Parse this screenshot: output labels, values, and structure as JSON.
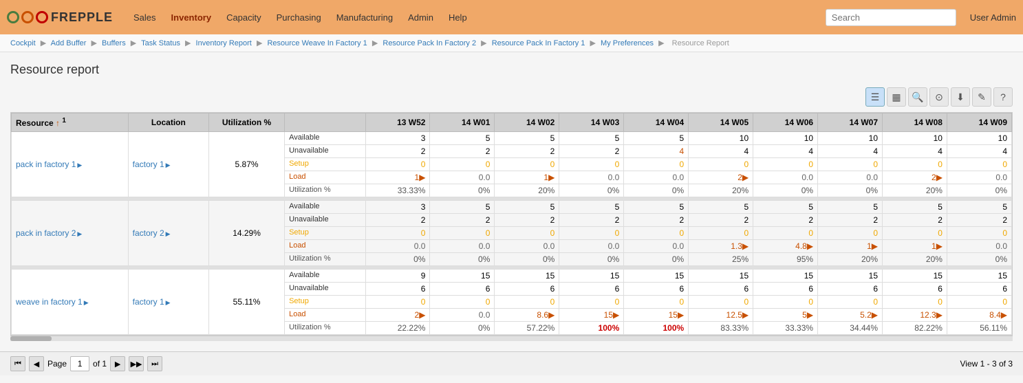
{
  "header": {
    "logo_text": "FREPPLE",
    "nav": [
      "Sales",
      "Inventory",
      "Capacity",
      "Purchasing",
      "Manufacturing",
      "Admin",
      "Help"
    ],
    "search_placeholder": "Search",
    "user": "User Admin"
  },
  "breadcrumb": {
    "items": [
      "Cockpit",
      "Add Buffer",
      "Buffers",
      "Task Status",
      "Inventory Report",
      "Resource Weave In Factory 1",
      "Resource Pack In Factory 2",
      "Resource Pack In Factory 1",
      "My Preferences",
      "Resource Report"
    ]
  },
  "page": {
    "title": "Resource report"
  },
  "toolbar": {
    "buttons": [
      "⊞",
      "🖼",
      "🔍",
      "⊙",
      "⬇",
      "✎",
      "?"
    ]
  },
  "table": {
    "col_headers": [
      "Resource",
      "Location",
      "Utilization %",
      "",
      "13 W52",
      "14 W01",
      "14 W02",
      "14 W03",
      "14 W04",
      "14 W05",
      "14 W06",
      "14 W07",
      "14 W08",
      "14 W09"
    ],
    "row_labels": [
      "Available",
      "Unavailable",
      "Setup",
      "Load",
      "Utilization %"
    ],
    "rows": [
      {
        "resource": "pack in factory 1",
        "location": "factory 1",
        "util_pct": "5.87%",
        "data": {
          "available": [
            3,
            5,
            5,
            5,
            5,
            10,
            10,
            10,
            10,
            10
          ],
          "unavailable": [
            2,
            2,
            2,
            2,
            4,
            4,
            4,
            4,
            4,
            4
          ],
          "setup": [
            "0",
            "0",
            "0",
            "0",
            "0",
            "0",
            "0",
            "0",
            "0",
            "0"
          ],
          "load": [
            "1▶",
            "0.0",
            "1▶",
            "0.0",
            "0.0",
            "2▶",
            "0.0",
            "0.0",
            "2▶",
            "0.0"
          ],
          "utilization": [
            "33.33%",
            "0%",
            "20%",
            "0%",
            "0%",
            "20%",
            "0%",
            "0%",
            "20%",
            "0%"
          ],
          "load_highlight": [
            true,
            false,
            true,
            false,
            false,
            true,
            false,
            false,
            true,
            false
          ],
          "util_red": [
            false,
            false,
            false,
            false,
            false,
            false,
            false,
            false,
            false,
            false
          ]
        }
      },
      {
        "resource": "pack in factory 2",
        "location": "factory 2",
        "util_pct": "14.29%",
        "data": {
          "available": [
            3,
            5,
            5,
            5,
            5,
            5,
            5,
            5,
            5,
            5
          ],
          "unavailable": [
            2,
            2,
            2,
            2,
            2,
            2,
            2,
            2,
            2,
            2
          ],
          "setup": [
            "0",
            "0",
            "0",
            "0",
            "0",
            "0",
            "0",
            "0",
            "0",
            "0"
          ],
          "load": [
            "0.0",
            "0.0",
            "0.0",
            "0.0",
            "0.0",
            "1.3▶",
            "4.8▶",
            "1▶",
            "1▶",
            "0.0"
          ],
          "utilization": [
            "0%",
            "0%",
            "0%",
            "0%",
            "0%",
            "25%",
            "95%",
            "20%",
            "20%",
            "0%"
          ],
          "load_highlight": [
            false,
            false,
            false,
            false,
            false,
            true,
            true,
            true,
            true,
            false
          ],
          "util_red": [
            false,
            false,
            false,
            false,
            false,
            false,
            false,
            false,
            false,
            false
          ]
        }
      },
      {
        "resource": "weave in factory 1",
        "location": "factory 1",
        "util_pct": "55.11%",
        "data": {
          "available": [
            9,
            15,
            15,
            15,
            15,
            15,
            15,
            15,
            15,
            15
          ],
          "unavailable": [
            6,
            6,
            6,
            6,
            6,
            6,
            6,
            6,
            6,
            6
          ],
          "setup": [
            "0",
            "0",
            "0",
            "0",
            "0",
            "0",
            "0",
            "0",
            "0",
            "0"
          ],
          "load": [
            "2▶",
            "0.0",
            "8.6▶",
            "15▶",
            "15▶",
            "12.5▶",
            "5▶",
            "5.2▶",
            "12.3▶",
            "8.4▶"
          ],
          "utilization": [
            "22.22%",
            "0%",
            "57.22%",
            "100%",
            "100%",
            "83.33%",
            "33.33%",
            "34.44%",
            "82.22%",
            "56.11%"
          ],
          "load_highlight": [
            true,
            false,
            true,
            true,
            true,
            true,
            true,
            true,
            true,
            true
          ],
          "util_red": [
            false,
            false,
            false,
            true,
            true,
            false,
            false,
            false,
            false,
            false
          ]
        }
      }
    ]
  },
  "footer": {
    "page_label": "Page",
    "page_num": "1",
    "of_label": "of 1",
    "view_info": "View 1 - 3 of 3"
  }
}
